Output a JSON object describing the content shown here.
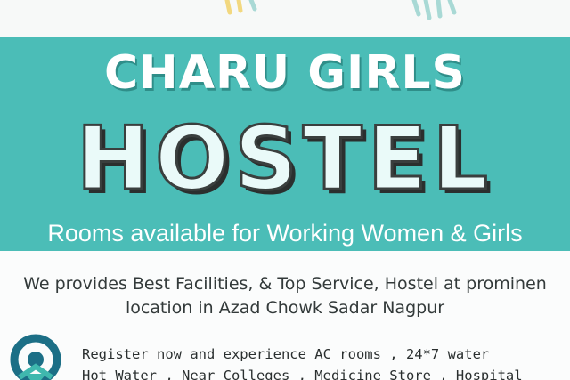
{
  "banner": {
    "title_line1": "CHARU GIRLS",
    "title_line2": "HOSTEL",
    "subtitle": "Rooms available for  Working Women & Girls",
    "background_color": "#4bbdb7"
  },
  "body": {
    "line1": "We provides Best Facilities, & Top Service, Hostel at prominen",
    "line2": "location in Azad Chowk Sadar Nagpur"
  },
  "register": {
    "line1": "Register now and experience AC rooms , 24*7 water",
    "line2": "Hot Water , Near Colleges , Medicine Store , Hospital"
  },
  "logo": {
    "icon": "location-pin-logo-icon",
    "color": "#1c6f86"
  }
}
